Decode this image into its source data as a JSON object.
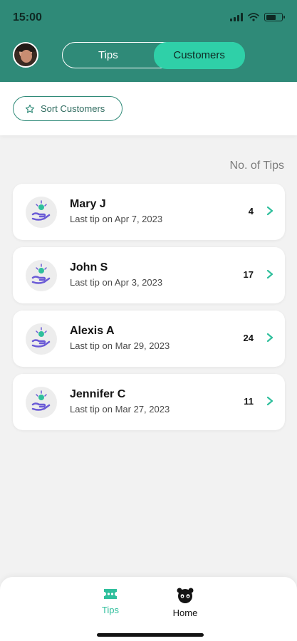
{
  "status_bar": {
    "time": "15:00"
  },
  "header": {
    "tabs": [
      {
        "label": "Tips",
        "active": false
      },
      {
        "label": "Customers",
        "active": true
      }
    ]
  },
  "sort": {
    "label": "Sort Customers",
    "icon": "star-icon"
  },
  "list": {
    "column_header": "No. of Tips",
    "customers": [
      {
        "name": "Mary J",
        "last_tip": "Last tip on Apr 7, 2023",
        "tips": "4"
      },
      {
        "name": "John S",
        "last_tip": "Last tip on Apr 3, 2023",
        "tips": "17"
      },
      {
        "name": "Alexis A",
        "last_tip": "Last tip on Mar 29, 2023",
        "tips": "24"
      },
      {
        "name": "Jennifer C",
        "last_tip": "Last tip on Mar 27, 2023",
        "tips": "11"
      }
    ]
  },
  "bottom_nav": {
    "items": [
      {
        "label": "Tips",
        "icon": "ticket-icon",
        "active": true
      },
      {
        "label": "Home",
        "icon": "panda-icon",
        "active": false
      }
    ]
  },
  "colors": {
    "header": "#2f8a78",
    "accent": "#2fd0a8",
    "tips_active": "#2fbf9c",
    "tip_icon": "#6b5bd6"
  }
}
